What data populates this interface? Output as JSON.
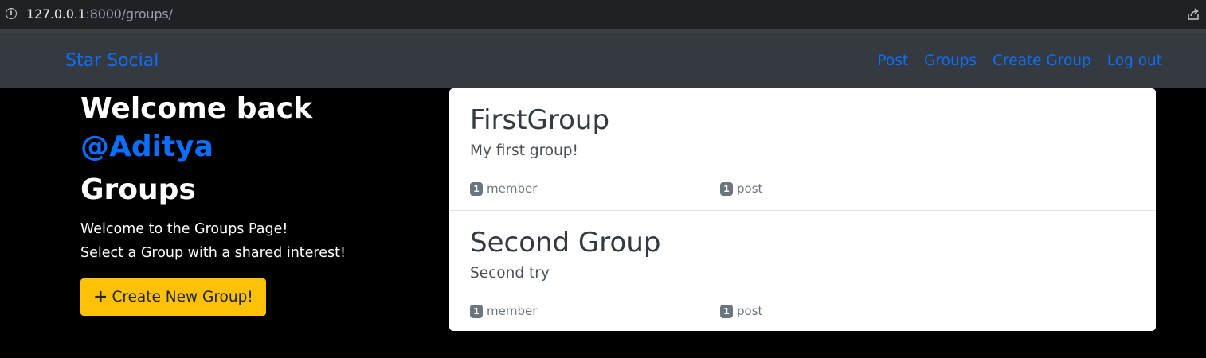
{
  "browser": {
    "url_host": "127.0.0.1",
    "url_rest": ":8000/groups/",
    "info_icon": "info-icon",
    "share_icon": "share-icon"
  },
  "navbar": {
    "brand": "Star Social",
    "links": [
      "Post",
      "Groups",
      "Create Group",
      "Log out"
    ]
  },
  "sidebar": {
    "welcome": "Welcome back",
    "username": "@Aditya",
    "heading": "Groups",
    "intro_line1": "Welcome to the Groups Page!",
    "intro_line2": "Select a Group with a shared interest!",
    "create_button": "Create New Group!"
  },
  "groups": [
    {
      "name": "FirstGroup",
      "description": "My first group!",
      "member_count": "1",
      "member_label": "member",
      "post_count": "1",
      "post_label": "post"
    },
    {
      "name": "Second Group",
      "description": "Second try",
      "member_count": "1",
      "member_label": "member",
      "post_count": "1",
      "post_label": "post"
    }
  ],
  "colors": {
    "accent": "#0d6efd",
    "navbar_bg": "#343a40",
    "button_bg": "#ffc107",
    "badge_bg": "#6c757d"
  }
}
